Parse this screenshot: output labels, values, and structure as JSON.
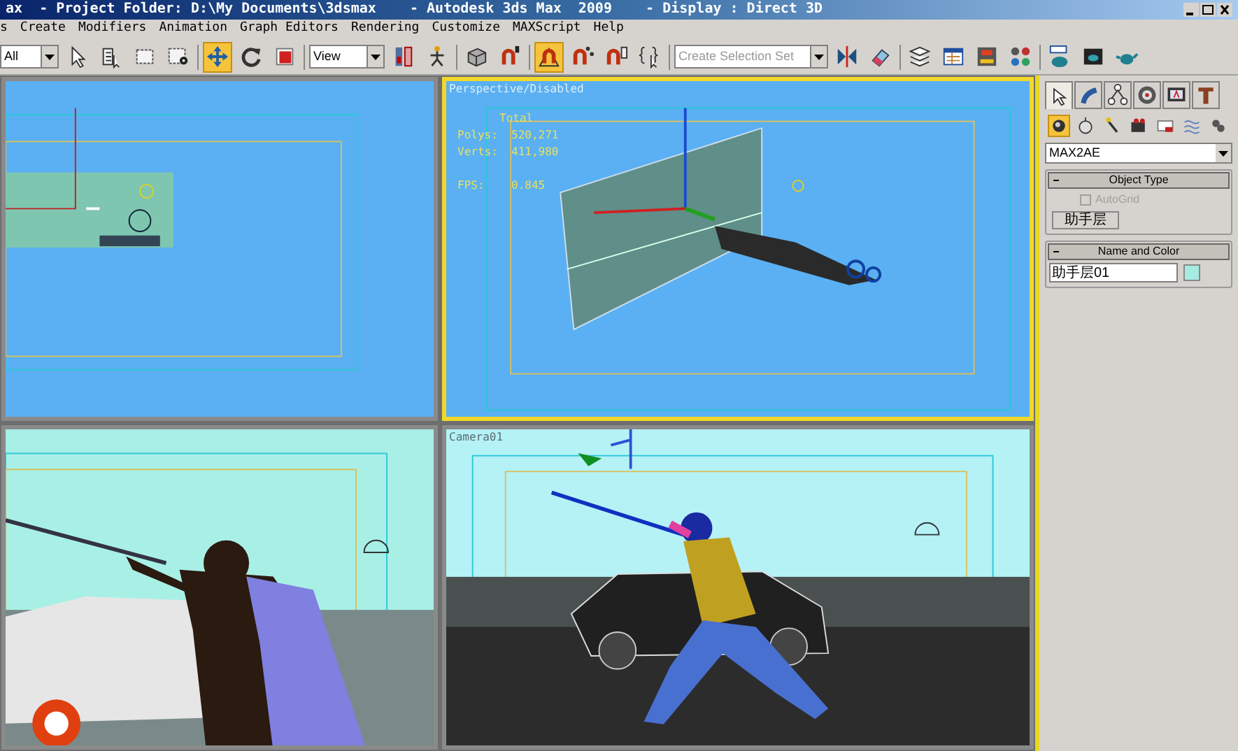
{
  "window": {
    "title": "ax  - Project Folder: D:\\My Documents\\3dsmax    - Autodesk 3ds Max  2009    - Display : Direct 3D"
  },
  "menu": [
    "s",
    "Create",
    "Modifiers",
    "Animation",
    "Graph Editors",
    "Rendering",
    "Customize",
    "MAXScript",
    "Help"
  ],
  "toolbar": [
    {
      "kind": "dropdown",
      "value": "All"
    },
    {
      "kind": "tool",
      "selected": false
    },
    {
      "kind": "tool",
      "selected": false
    },
    {
      "kind": "tool",
      "selected": false
    },
    {
      "kind": "tool",
      "selected": false
    },
    {
      "kind": "tool",
      "selected": true
    },
    {
      "kind": "tool",
      "selected": false
    },
    {
      "kind": "tool",
      "selected": false
    },
    {
      "kind": "dropdown",
      "value": "View"
    },
    {
      "kind": "tool",
      "selected": false
    },
    {
      "kind": "tool",
      "selected": false
    },
    {
      "kind": "tool",
      "selected": false
    },
    {
      "kind": "tool",
      "selected": false
    },
    {
      "kind": "tool",
      "selected": true
    },
    {
      "kind": "tool",
      "selected": false
    },
    {
      "kind": "tool",
      "selected": false
    },
    {
      "kind": "tool",
      "selected": false
    },
    {
      "kind": "dropdown",
      "placeholder": "Create Selection Set"
    },
    {
      "kind": "tool",
      "selected": false
    },
    {
      "kind": "tool",
      "selected": false
    },
    {
      "kind": "tool",
      "selected": false
    },
    {
      "kind": "tool",
      "selected": false
    },
    {
      "kind": "tool",
      "selected": false
    },
    {
      "kind": "tool",
      "selected": false
    },
    {
      "kind": "tool",
      "selected": false
    },
    {
      "kind": "tool",
      "selected": false
    },
    {
      "kind": "tool",
      "selected": false
    }
  ],
  "viewports": [
    {
      "active": false
    },
    {
      "label": "Perspective/Disabled",
      "active": true,
      "stats": [
        "Total",
        "Polys:  520,271",
        "Verts:  411,980",
        "FPS:    0.845"
      ]
    },
    {
      "active": false
    },
    {
      "label": "Camera01",
      "active": false
    }
  ],
  "command_panel": {
    "tabs": [
      {
        "selected": true
      },
      {
        "selected": false
      },
      {
        "selected": false
      },
      {
        "selected": false
      },
      {
        "selected": false
      },
      {
        "selected": false
      }
    ],
    "categories": [
      {
        "selected": true
      },
      {
        "selected": false
      },
      {
        "selected": false
      },
      {
        "selected": false
      },
      {
        "selected": false
      },
      {
        "selected": false
      },
      {
        "selected": false
      }
    ],
    "category_dropdown": "MAX2AE",
    "object_type": {
      "title": "Object Type",
      "autogrid": {
        "label": "AutoGrid",
        "checked": false,
        "disabled": true
      },
      "buttons": [
        "助手层"
      ]
    },
    "name_and_color": {
      "title": "Name and Color",
      "name": "助手层01",
      "color": "#a6ece2"
    }
  }
}
